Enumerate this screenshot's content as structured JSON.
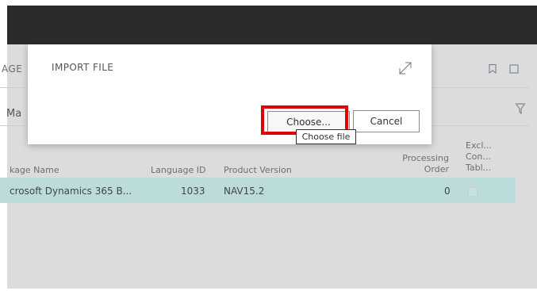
{
  "page": {
    "title_fragment": "AGE",
    "tab_fragment": "Ma"
  },
  "dialog": {
    "title": "IMPORT FILE",
    "choose_label": "Choose...",
    "cancel_label": "Cancel",
    "tooltip": "Choose file"
  },
  "table": {
    "headers": {
      "package_name": "kage Name",
      "language_id": "Language ID",
      "product_version": "Product Version",
      "processing_order": [
        "Processing",
        "Order"
      ],
      "exclude": [
        "Excl...",
        "Con...",
        "Tabl..."
      ]
    },
    "rows": [
      {
        "package_name": "crosoft Dynamics 365 B...",
        "language_id": "1033",
        "product_version": "NAV15.2",
        "processing_order": "0",
        "exclude": false
      }
    ]
  },
  "colors": {
    "highlight": "#e00000",
    "selected_row": "#bcdcdc",
    "topbar": "#2b2b2b"
  },
  "icons": [
    "expand-icon",
    "bookmark-icon",
    "more-icon",
    "filter-icon"
  ]
}
